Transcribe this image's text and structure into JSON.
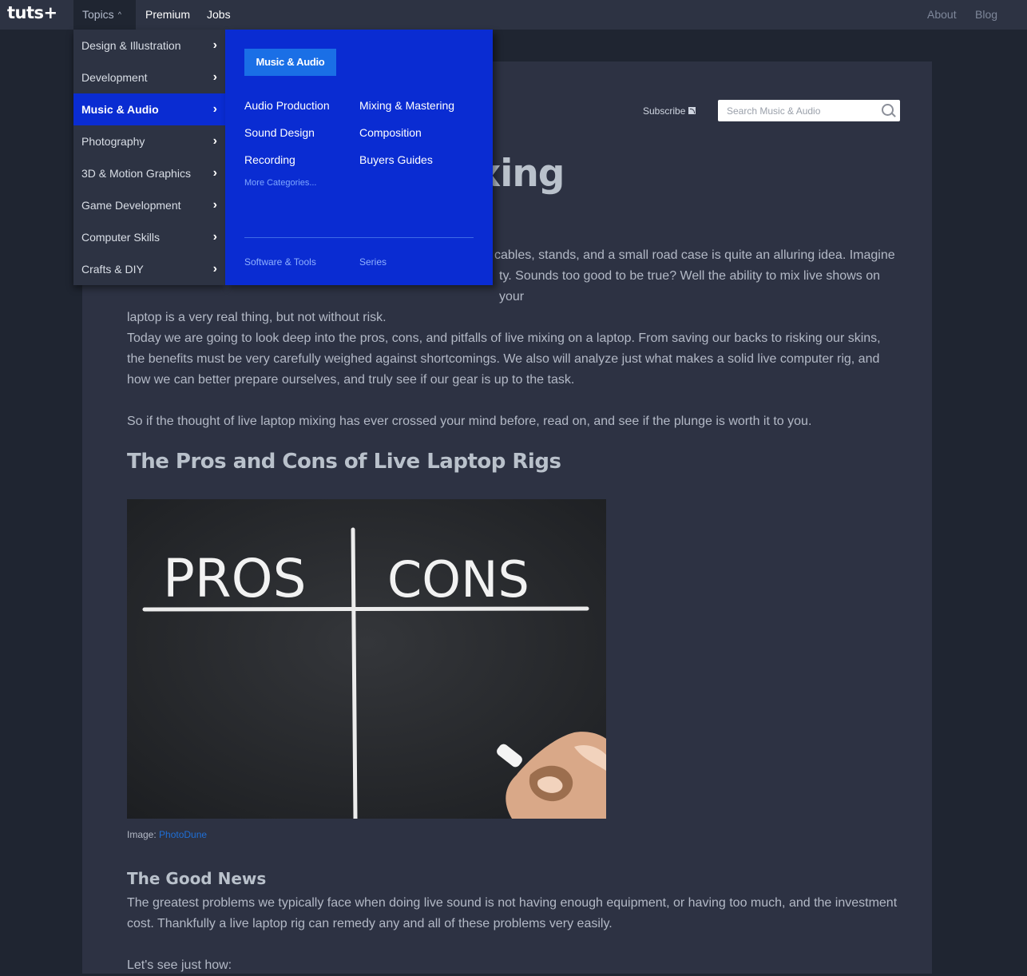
{
  "topbar": {
    "logo": "tuts+",
    "topics": "Topics",
    "premium": "Premium",
    "jobs": "Jobs",
    "about": "About",
    "blog": "Blog"
  },
  "dropdown": {
    "categories": [
      {
        "label": "Design & Illustration"
      },
      {
        "label": "Development"
      },
      {
        "label": "Music & Audio",
        "active": true
      },
      {
        "label": "Photography"
      },
      {
        "label": "3D & Motion Graphics"
      },
      {
        "label": "Game Development"
      },
      {
        "label": "Computer Skills"
      },
      {
        "label": "Crafts & DIY"
      }
    ],
    "panel": {
      "badge": "Music & Audio",
      "links_col1": [
        "Audio Production",
        "Sound Design",
        "Recording"
      ],
      "links_col2": [
        "Mixing & Mastering",
        "Composition",
        "Buyers Guides"
      ],
      "more": "More Categories...",
      "footer": [
        "Software & Tools",
        "Series"
      ]
    }
  },
  "article": {
    "subscribe": "Subscribe",
    "search_placeholder": "Search Music & Audio",
    "title_visible": "e: Live Laptop Mixing",
    "p1_line1": "cables, stands, and a small road case is quite an alluring idea. Imagine",
    "p1_line2": "ty. Sounds too good to be true? Well the ability to mix live shows on your",
    "p1_line3": "laptop is a very real thing, but not without risk.",
    "p2": "Today we are going to look deep into the pros, cons, and pitfalls of live mixing on a laptop. From saving our backs to risking our skins, the benefits must be very carefully weighed against shortcomings. We also will analyze just what makes a solid live computer rig, and how we can better prepare ourselves, and truly see if our gear is up to the task.",
    "p3": "So if the thought of live laptop mixing has ever crossed your mind before, read on, and see if the plunge is worth it to you.",
    "h2": "The Pros and Cons of Live Laptop Rigs",
    "image_text_left": "PROS",
    "image_text_right": "CONS",
    "caption_label": "Image:",
    "caption_link": "PhotoDune",
    "h3": "The Good News",
    "p4": "The greatest problems we typically face when doing live sound is not having enough equipment, or having too much, and the investment cost. Thankfully a live laptop rig can remedy any and all of these problems very easily.",
    "p5": "Let's see just how:"
  },
  "colors": {
    "menu_active": "#0a2cd2",
    "panel_bg": "#0a2cd2",
    "badge_bg": "#1a6fe6",
    "topbar_bg": "#2d3343",
    "link_blue": "#1f6fd6"
  },
  "icons": {
    "chevron": "chevron-right-icon",
    "caret": "caret-up-icon",
    "rss": "rss-icon",
    "search": "search-icon"
  }
}
